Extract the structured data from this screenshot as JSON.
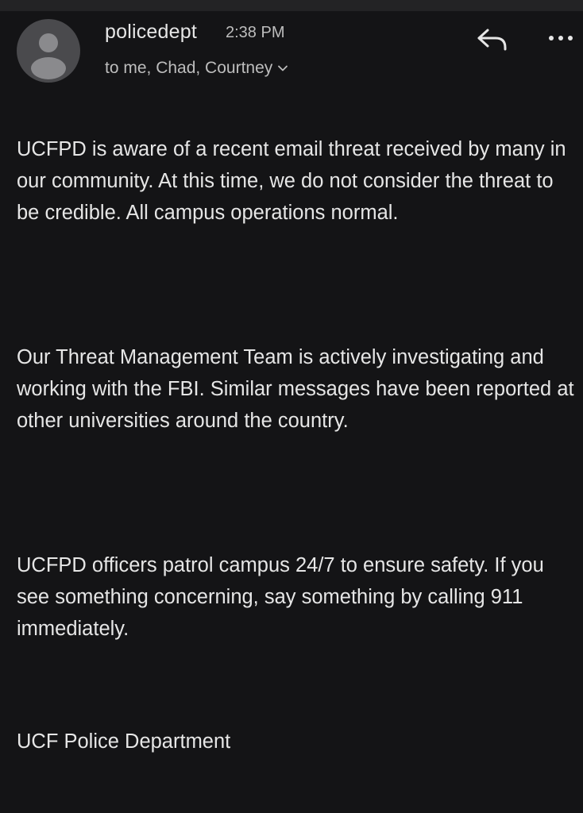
{
  "email": {
    "sender": "policedept",
    "time": "2:38 PM",
    "recipients": "to me, Chad, Courtney",
    "icons": {
      "avatar": "default-person-avatar",
      "reply": "reply-arrow-icon",
      "more": "more-options-icon",
      "expand": "chevron-down-icon"
    },
    "body": {
      "paragraph_1": "UCFPD is aware of a recent email threat received by many in our community. At this time, we do not consider the threat to be credible. All campus operations normal.",
      "paragraph_2": "Our Threat Management Team is actively investigating and working with the FBI. Similar messages have been reported at other universities around the country.",
      "paragraph_3": "UCFPD officers patrol campus 24/7 to ensure safety. If you see something concerning, say something by calling 911 immediately.",
      "signature": "UCF Police Department"
    }
  },
  "colors": {
    "background": "#141416",
    "text": "#e6e6e6",
    "secondary_text": "#bdbdbd",
    "avatar_bg": "#4a4a4d",
    "avatar_figure": "#8a8a8d"
  }
}
